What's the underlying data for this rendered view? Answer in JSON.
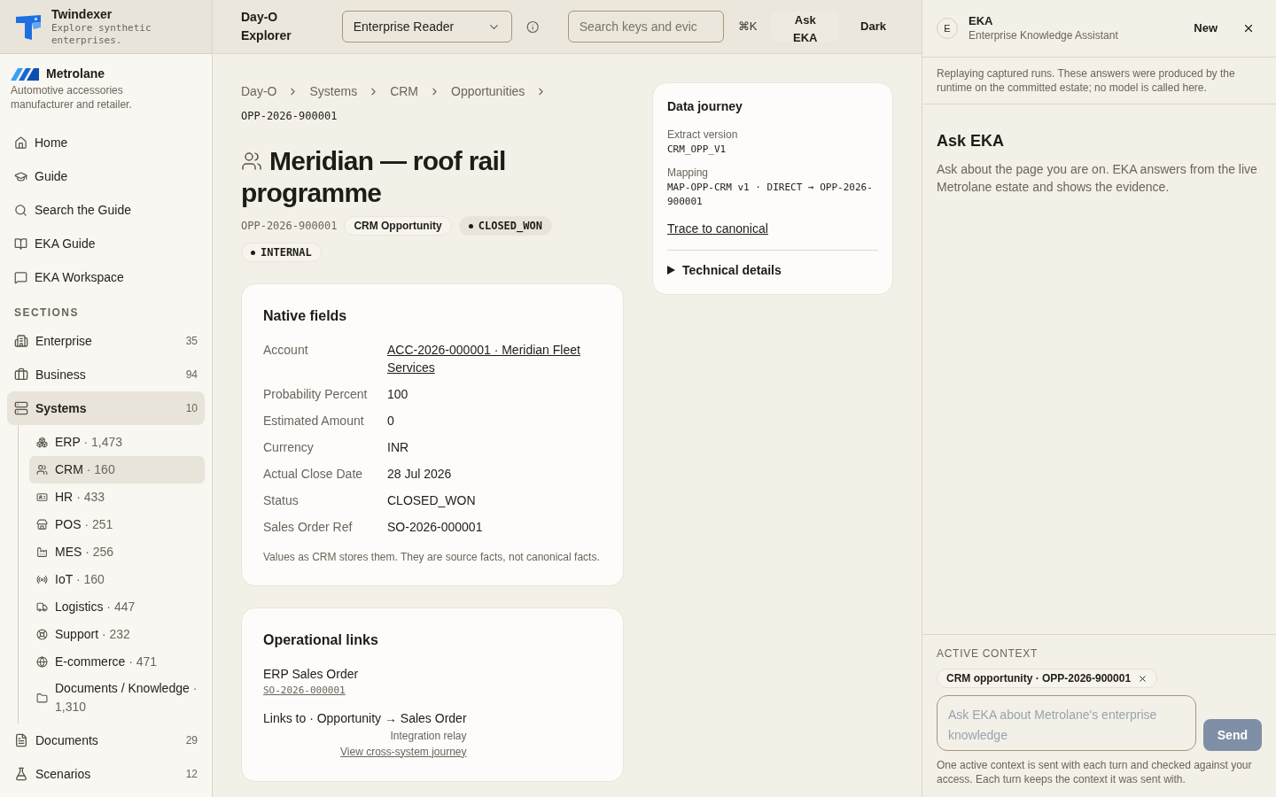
{
  "brand": {
    "name": "Twindexer",
    "tagline": "Explore synthetic enterprises."
  },
  "company": {
    "name": "Metrolane",
    "description": "Automotive accessories manufacturer and retailer."
  },
  "nav": [
    {
      "label": "Home"
    },
    {
      "label": "Guide"
    },
    {
      "label": "Search the Guide"
    },
    {
      "label": "EKA Guide"
    },
    {
      "label": "EKA Workspace"
    }
  ],
  "sections_heading": "SECTIONS",
  "sections": [
    {
      "label": "Enterprise",
      "count": "35",
      "selected": false
    },
    {
      "label": "Business",
      "count": "94",
      "selected": false
    },
    {
      "label": "Systems",
      "count": "10",
      "selected": true,
      "children": [
        {
          "label": "ERP",
          "count": "· 1,473",
          "selected": false
        },
        {
          "label": "CRM",
          "count": "· 160",
          "selected": true
        },
        {
          "label": "HR",
          "count": "· 433",
          "selected": false
        },
        {
          "label": "POS",
          "count": "· 251",
          "selected": false
        },
        {
          "label": "MES",
          "count": "· 256",
          "selected": false
        },
        {
          "label": "IoT",
          "count": "· 160",
          "selected": false
        },
        {
          "label": "Logistics",
          "count": "· 447",
          "selected": false
        },
        {
          "label": "Support",
          "count": "· 232",
          "selected": false
        },
        {
          "label": "E-commerce",
          "count": "· 471",
          "selected": false
        },
        {
          "label": "Documents / Knowledge",
          "count": "· 1,310",
          "selected": false
        }
      ]
    },
    {
      "label": "Documents",
      "count": "29",
      "selected": false
    },
    {
      "label": "Scenarios",
      "count": "12",
      "selected": false
    }
  ],
  "topbar": {
    "title": "Day-O Explorer",
    "role": "Enterprise Reader",
    "search_placeholder": "Search keys and evic",
    "shortcut": "⌘K",
    "ask_button": "Ask EKA",
    "theme_button": "Dark"
  },
  "breadcrumb": [
    "Day-O",
    "Systems",
    "CRM",
    "Opportunities"
  ],
  "record_id": "OPP-2026-900001",
  "title": "Meridian — roof rail programme",
  "meta": {
    "id": "OPP-2026-900001",
    "type": "CRM Opportunity",
    "status": "CLOSED_WON",
    "classification": "INTERNAL"
  },
  "native_fields": {
    "title": "Native fields",
    "rows": [
      {
        "label": "Account",
        "value": "ACC-2026-000001 · Meridian Fleet Services",
        "kind": "link"
      },
      {
        "label": "Probability Percent",
        "value": "100",
        "kind": "text"
      },
      {
        "label": "Estimated Amount",
        "value": "0",
        "kind": "text"
      },
      {
        "label": "Currency",
        "value": "INR",
        "kind": "text"
      },
      {
        "label": "Actual Close Date",
        "value": "28 Jul 2026",
        "kind": "text"
      },
      {
        "label": "Status",
        "value": "CLOSED_WON",
        "kind": "text"
      },
      {
        "label": "Sales Order Ref",
        "value": "SO-2026-000001",
        "kind": "text"
      }
    ],
    "note": "Values as CRM stores them. They are source facts, not canonical facts."
  },
  "operational_links": {
    "title": "Operational links",
    "items": [
      {
        "label": "ERP Sales Order",
        "ref": "SO-2026-000001"
      }
    ],
    "relation": {
      "label": "Links to · Opportunity → Sales Order",
      "via": "Integration relay",
      "link": "View cross-system journey"
    }
  },
  "data_journey": {
    "title": "Data journey",
    "extract_label": "Extract version",
    "extract_value": "CRM_OPP_V1",
    "mapping_label": "Mapping",
    "mapping_value": "MAP-OPP-CRM v1 · DIRECT → OPP-2026-900001",
    "trace_link": "Trace to canonical",
    "details": {
      "label": "Technical details",
      "expanded": false
    }
  },
  "assistant": {
    "avatar": "E",
    "name": "EKA",
    "subtitle": "Enterprise Knowledge Assistant",
    "new_button": "New",
    "notice": "Replaying captured runs. These answers were produced by the runtime on the committed estate; no model is called here.",
    "heading": "Ask EKA",
    "intro": "Ask about the page you are on. EKA answers from the live Metrolane estate and shows the evidence.",
    "context_heading": "ACTIVE CONTEXT",
    "context_chip": "CRM opportunity · OPP-2026-900001",
    "input_placeholder": "Ask EKA about Metrolane's enterprise knowledge",
    "send_button": "Send",
    "send_disabled": true,
    "footnote": "One active context is sent with each turn and checked against your access. Each turn keeps the context it was sent with."
  }
}
